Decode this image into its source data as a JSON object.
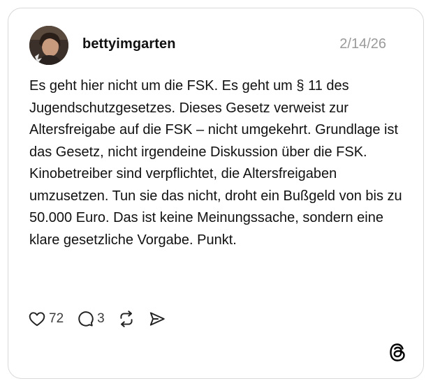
{
  "post": {
    "username": "bettyimgarten",
    "date": "2/14/26",
    "paragraphs": [
      "Es geht hier nicht um die FSK. Es geht um § 11 des Jugendschutzgesetzes. Dieses Gesetz verweist zur Altersfreigabe auf die FSK – nicht umgekehrt. Grundlage ist das Gesetz, nicht irgendeine Diskussion über die FSK.",
      "Kinobetreiber sind verpflichtet, die Altersfreigaben umzusetzen. Tun sie das nicht, droht ein Bußgeld von bis zu 50.000 Euro. Das ist keine Meinungssache, sondern eine klare gesetzliche Vorgabe. Punkt."
    ]
  },
  "actions": {
    "like_count": "72",
    "reply_count": "3"
  },
  "icons": [
    "heart-icon",
    "comment-icon",
    "repost-icon",
    "share-icon",
    "threads-logo-icon"
  ],
  "colors": {
    "text": "#101010",
    "muted": "#9a9a9a",
    "border": "#d9d9d9"
  }
}
